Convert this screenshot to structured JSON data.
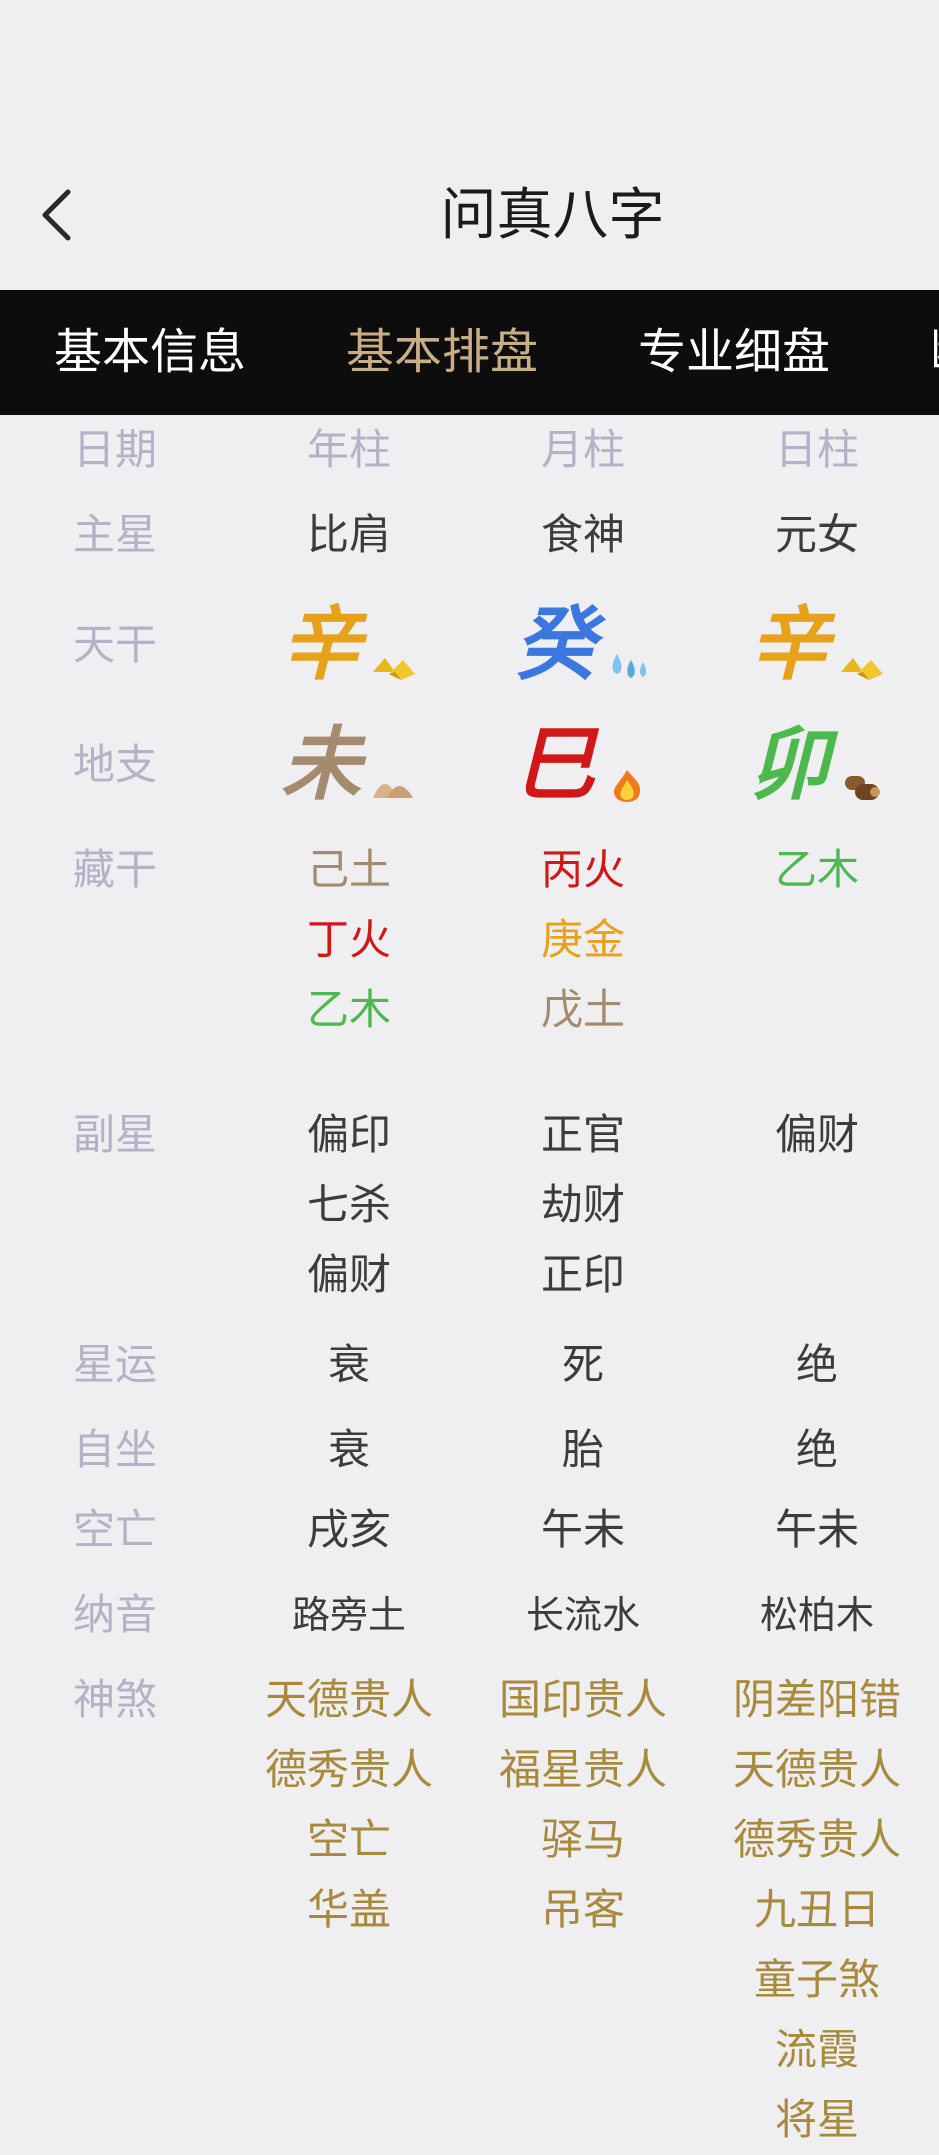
{
  "header": {
    "title": "问真八字",
    "back_icon": "back-chevron-icon"
  },
  "tabs": [
    {
      "label": "基本信息",
      "active": false
    },
    {
      "label": "基本排盘",
      "active": true
    },
    {
      "label": "专业细盘",
      "active": false
    },
    {
      "label": "断",
      "active": false
    }
  ],
  "colors": {
    "label": "#b3b3c8",
    "text": "#3c3c3c",
    "accent_tab": "#c9ad86",
    "metal": "#e8a21a",
    "water": "#3a78e0",
    "earth": "#a58b6e",
    "fire": "#d01818",
    "wood": "#4db84d",
    "shensha": "#a88a3c"
  },
  "labels": [
    "日期",
    "主星",
    "天干",
    "地支",
    "藏干",
    "副星",
    "星运",
    "自坐",
    "空亡",
    "纳音",
    "神煞"
  ],
  "columns": [
    {
      "header": "年柱",
      "main_star": "比肩",
      "stem": {
        "char": "辛",
        "element": "metal",
        "icon": "gold-ingot-icon"
      },
      "branch": {
        "char": "未",
        "element": "earth",
        "icon": "earth-mound-icon"
      },
      "hidden_stems": [
        {
          "text": "己土",
          "element": "earth"
        },
        {
          "text": "丁火",
          "element": "fire"
        },
        {
          "text": "乙木",
          "element": "wood"
        }
      ],
      "sub_stars": [
        "偏印",
        "七杀",
        "偏财"
      ],
      "star_fortune": "衰",
      "self_seat": "衰",
      "void": "戌亥",
      "nayin": "路旁土",
      "shensha": [
        "天德贵人",
        "德秀贵人",
        "空亡",
        "华盖"
      ]
    },
    {
      "header": "月柱",
      "main_star": "食神",
      "stem": {
        "char": "癸",
        "element": "water",
        "icon": "water-drops-icon"
      },
      "branch": {
        "char": "巳",
        "element": "fire",
        "icon": "flame-icon"
      },
      "hidden_stems": [
        {
          "text": "丙火",
          "element": "fire"
        },
        {
          "text": "庚金",
          "element": "metal"
        },
        {
          "text": "戊土",
          "element": "earth"
        }
      ],
      "sub_stars": [
        "正官",
        "劫财",
        "正印"
      ],
      "star_fortune": "死",
      "self_seat": "胎",
      "void": "午未",
      "nayin": "长流水",
      "shensha": [
        "国印贵人",
        "福星贵人",
        "驿马",
        "吊客"
      ]
    },
    {
      "header": "日柱",
      "main_star": "元女",
      "stem": {
        "char": "辛",
        "element": "metal",
        "icon": "gold-ingot-icon"
      },
      "branch": {
        "char": "卯",
        "element": "wood",
        "icon": "wood-logs-icon"
      },
      "hidden_stems": [
        {
          "text": "乙木",
          "element": "wood"
        }
      ],
      "sub_stars": [
        "偏财"
      ],
      "star_fortune": "绝",
      "self_seat": "绝",
      "void": "午未",
      "nayin": "松柏木",
      "shensha": [
        "阴差阳错",
        "天德贵人",
        "德秀贵人",
        "九丑日",
        "童子煞",
        "流霞",
        "将星"
      ]
    }
  ]
}
